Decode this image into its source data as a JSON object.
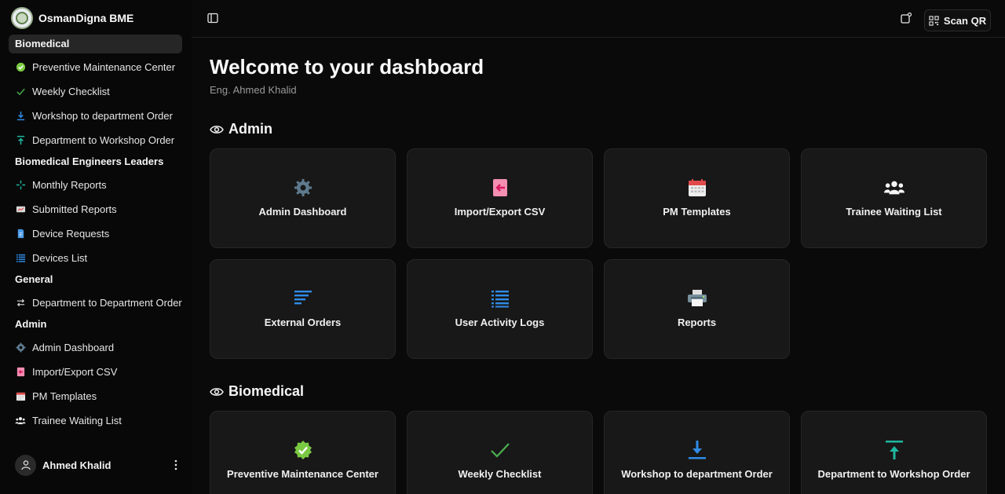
{
  "brand": {
    "name": "OsmanDigna BME"
  },
  "sidebar": {
    "groups": [
      {
        "label": "Biomedical",
        "items": [
          {
            "label": "Preventive Maintenance Center",
            "icon": "check-badge-icon"
          },
          {
            "label": "Weekly Checklist",
            "icon": "check-icon"
          },
          {
            "label": "Workshop to department Order",
            "icon": "arrow-down-icon"
          },
          {
            "label": "Department to Workshop Order",
            "icon": "arrow-up-icon"
          }
        ]
      },
      {
        "label": "Biomedical Engineers Leaders",
        "items": [
          {
            "label": "Monthly Reports",
            "icon": "sparkle-icon"
          },
          {
            "label": "Submitted Reports",
            "icon": "envelope-chart-icon"
          },
          {
            "label": "Device Requests",
            "icon": "document-icon"
          },
          {
            "label": "Devices List",
            "icon": "list-icon"
          }
        ]
      },
      {
        "label": "General",
        "items": [
          {
            "label": "Department to Department Order",
            "icon": "swap-icon"
          }
        ]
      },
      {
        "label": "Admin",
        "items": [
          {
            "label": "Admin Dashboard",
            "icon": "gear-icon"
          },
          {
            "label": "Import/Export CSV",
            "icon": "import-icon"
          },
          {
            "label": "PM Templates",
            "icon": "calendar-icon"
          },
          {
            "label": "Trainee Waiting List",
            "icon": "users-icon"
          }
        ]
      }
    ]
  },
  "user": {
    "name": "Ahmed Khalid"
  },
  "topbar": {
    "scan_label": "Scan QR"
  },
  "page": {
    "title": "Welcome to your dashboard",
    "subtitle": "Eng. Ahmed Khalid"
  },
  "sections": {
    "admin": {
      "title": "Admin",
      "cards": [
        {
          "label": "Admin Dashboard",
          "icon": "gear-icon"
        },
        {
          "label": "Import/Export CSV",
          "icon": "import-icon"
        },
        {
          "label": "PM Templates",
          "icon": "calendar-icon"
        },
        {
          "label": "Trainee Waiting List",
          "icon": "users-icon"
        },
        {
          "label": "External Orders",
          "icon": "sort-lines-icon"
        },
        {
          "label": "User Activity Logs",
          "icon": "list-icon"
        },
        {
          "label": "Reports",
          "icon": "printer-icon"
        }
      ]
    },
    "biomedical": {
      "title": "Biomedical",
      "cards": [
        {
          "label": "Preventive Maintenance Center",
          "icon": "check-badge-icon"
        },
        {
          "label": "Weekly Checklist",
          "icon": "check-icon"
        },
        {
          "label": "Workshop to department Order",
          "icon": "arrow-down-icon"
        },
        {
          "label": "Department to Workshop Order",
          "icon": "arrow-up-icon"
        }
      ]
    }
  },
  "colors": {
    "green": "#7ac943",
    "blue": "#2f8be6",
    "teal": "#1fb8a0",
    "pink": "#ec4f8f",
    "red": "#e04a4a",
    "gray_icon": "#5e7a8f"
  }
}
